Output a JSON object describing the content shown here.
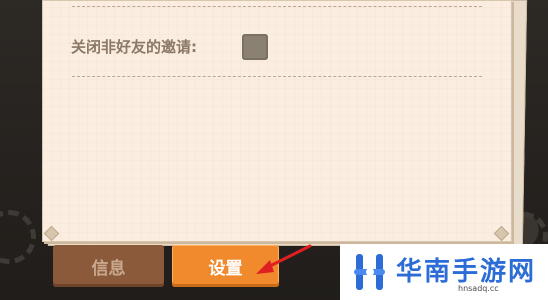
{
  "settings_dialog": {
    "decline_non_friend_invites_label": "关闭非好友的邀请:",
    "decline_non_friend_invites_checked": false
  },
  "tabs": [
    {
      "label": "信息",
      "active": false
    },
    {
      "label": "设置",
      "active": true
    }
  ],
  "watermark": {
    "brand_text": "华南手游网",
    "url": "hnsadq.cc"
  },
  "colors": {
    "panel": "#fbeee0",
    "active_tab": "#f08a2c",
    "inactive_tab": "#8a5a3a",
    "annotation_arrow": "#e02020",
    "watermark_blue": "#2c6cd6"
  },
  "icons": {
    "annotation": "red-arrow-icon",
    "watermark_logo": "h-logo-icon"
  }
}
